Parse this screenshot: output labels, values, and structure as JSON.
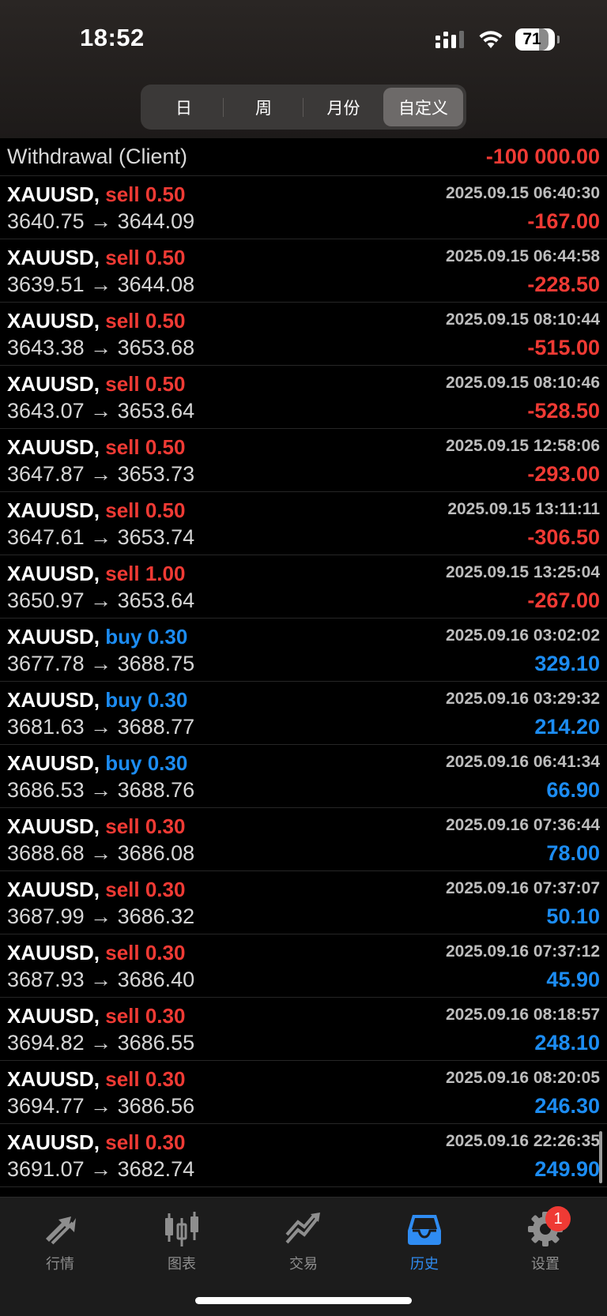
{
  "status_bar": {
    "time": "18:52",
    "battery": "71"
  },
  "segmented": {
    "tabs": [
      {
        "label": "日"
      },
      {
        "label": "周"
      },
      {
        "label": "月份"
      },
      {
        "label": "自定义"
      }
    ],
    "active_index": 3
  },
  "withdrawal": {
    "label": "Withdrawal (Client)",
    "amount": "-100 000.00"
  },
  "trades": [
    {
      "symbol": "XAUUSD,",
      "action": "sell 0.50",
      "side": "sell",
      "time": "2025.09.15 06:40:30",
      "prices": "3640.75 → 3644.09",
      "profit": "-167.00"
    },
    {
      "symbol": "XAUUSD,",
      "action": "sell 0.50",
      "side": "sell",
      "time": "2025.09.15 06:44:58",
      "prices": "3639.51 → 3644.08",
      "profit": "-228.50"
    },
    {
      "symbol": "XAUUSD,",
      "action": "sell 0.50",
      "side": "sell",
      "time": "2025.09.15 08:10:44",
      "prices": "3643.38 → 3653.68",
      "profit": "-515.00"
    },
    {
      "symbol": "XAUUSD,",
      "action": "sell 0.50",
      "side": "sell",
      "time": "2025.09.15 08:10:46",
      "prices": "3643.07 → 3653.64",
      "profit": "-528.50"
    },
    {
      "symbol": "XAUUSD,",
      "action": "sell 0.50",
      "side": "sell",
      "time": "2025.09.15 12:58:06",
      "prices": "3647.87 → 3653.73",
      "profit": "-293.00"
    },
    {
      "symbol": "XAUUSD,",
      "action": "sell 0.50",
      "side": "sell",
      "time": "2025.09.15 13:11:11",
      "prices": "3647.61 → 3653.74",
      "profit": "-306.50"
    },
    {
      "symbol": "XAUUSD,",
      "action": "sell 1.00",
      "side": "sell",
      "time": "2025.09.15 13:25:04",
      "prices": "3650.97 → 3653.64",
      "profit": "-267.00"
    },
    {
      "symbol": "XAUUSD,",
      "action": "buy 0.30",
      "side": "buy",
      "time": "2025.09.16 03:02:02",
      "prices": "3677.78 → 3688.75",
      "profit": "329.10"
    },
    {
      "symbol": "XAUUSD,",
      "action": "buy 0.30",
      "side": "buy",
      "time": "2025.09.16 03:29:32",
      "prices": "3681.63 → 3688.77",
      "profit": "214.20"
    },
    {
      "symbol": "XAUUSD,",
      "action": "buy 0.30",
      "side": "buy",
      "time": "2025.09.16 06:41:34",
      "prices": "3686.53 → 3688.76",
      "profit": "66.90"
    },
    {
      "symbol": "XAUUSD,",
      "action": "sell 0.30",
      "side": "sell",
      "time": "2025.09.16 07:36:44",
      "prices": "3688.68 → 3686.08",
      "profit": "78.00"
    },
    {
      "symbol": "XAUUSD,",
      "action": "sell 0.30",
      "side": "sell",
      "time": "2025.09.16 07:37:07",
      "prices": "3687.99 → 3686.32",
      "profit": "50.10"
    },
    {
      "symbol": "XAUUSD,",
      "action": "sell 0.30",
      "side": "sell",
      "time": "2025.09.16 07:37:12",
      "prices": "3687.93 → 3686.40",
      "profit": "45.90"
    },
    {
      "symbol": "XAUUSD,",
      "action": "sell 0.30",
      "side": "sell",
      "time": "2025.09.16 08:18:57",
      "prices": "3694.82 → 3686.55",
      "profit": "248.10"
    },
    {
      "symbol": "XAUUSD,",
      "action": "sell 0.30",
      "side": "sell",
      "time": "2025.09.16 08:20:05",
      "prices": "3694.77 → 3686.56",
      "profit": "246.30"
    },
    {
      "symbol": "XAUUSD,",
      "action": "sell 0.30",
      "side": "sell",
      "time": "2025.09.16 22:26:35",
      "prices": "3691.07 → 3682.74",
      "profit": "249.90"
    }
  ],
  "tabbar": {
    "tabs": [
      {
        "label": "行情",
        "icon": "quotes-arrows-icon"
      },
      {
        "label": "图表",
        "icon": "candlestick-chart-icon"
      },
      {
        "label": "交易",
        "icon": "trade-trend-icon"
      },
      {
        "label": "历史",
        "icon": "history-inbox-icon"
      },
      {
        "label": "设置",
        "icon": "gear-icon"
      }
    ],
    "active_index": 3,
    "settings_badge": "1"
  },
  "colors": {
    "sell": "#ef3a34",
    "buy": "#1c8cf2",
    "active_tab": "#2f8cf2",
    "inactive_tab": "#8e8e8e"
  }
}
